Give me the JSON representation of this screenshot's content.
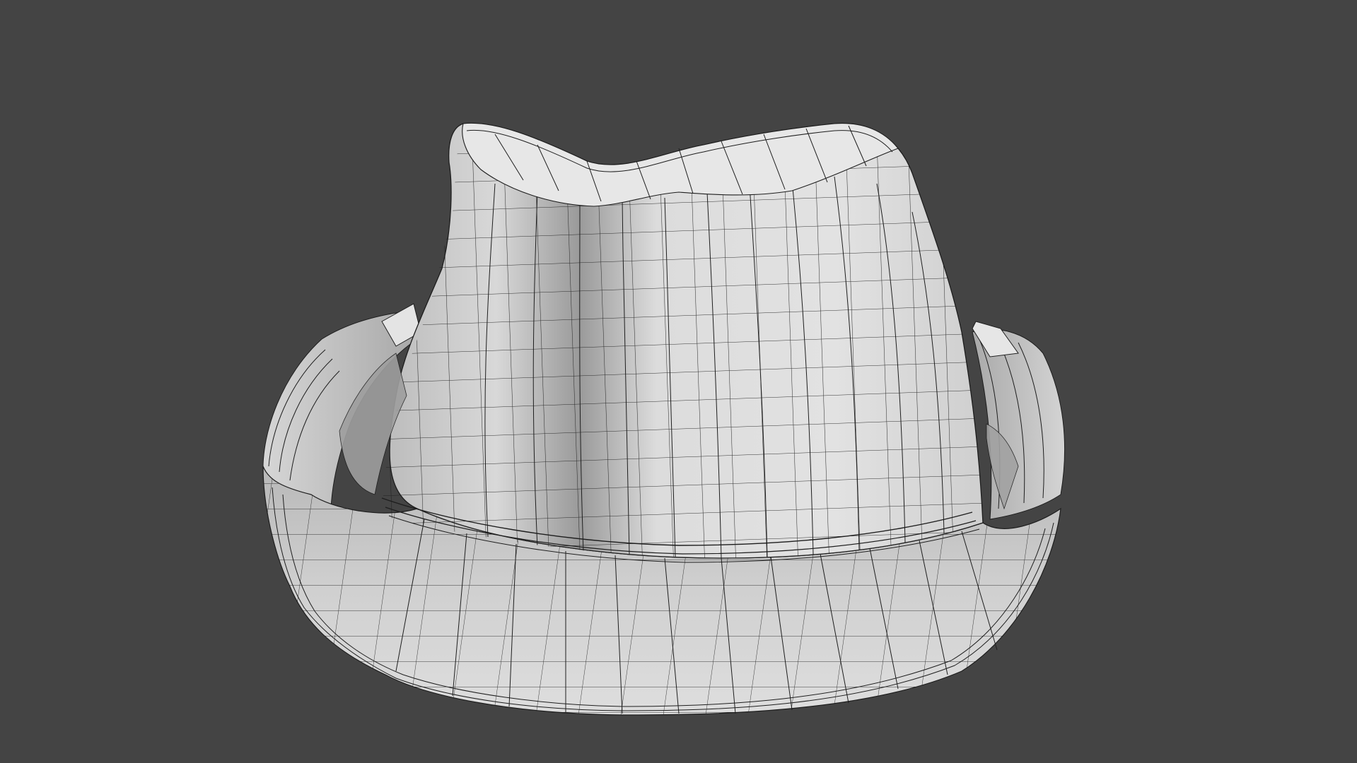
{
  "scene": {
    "background_color": "#444444",
    "subject": "hat-mesh",
    "render_style": "clay-wireframe",
    "mesh_color": "#d9d9d9",
    "wire_color": "#1e1e1e"
  }
}
